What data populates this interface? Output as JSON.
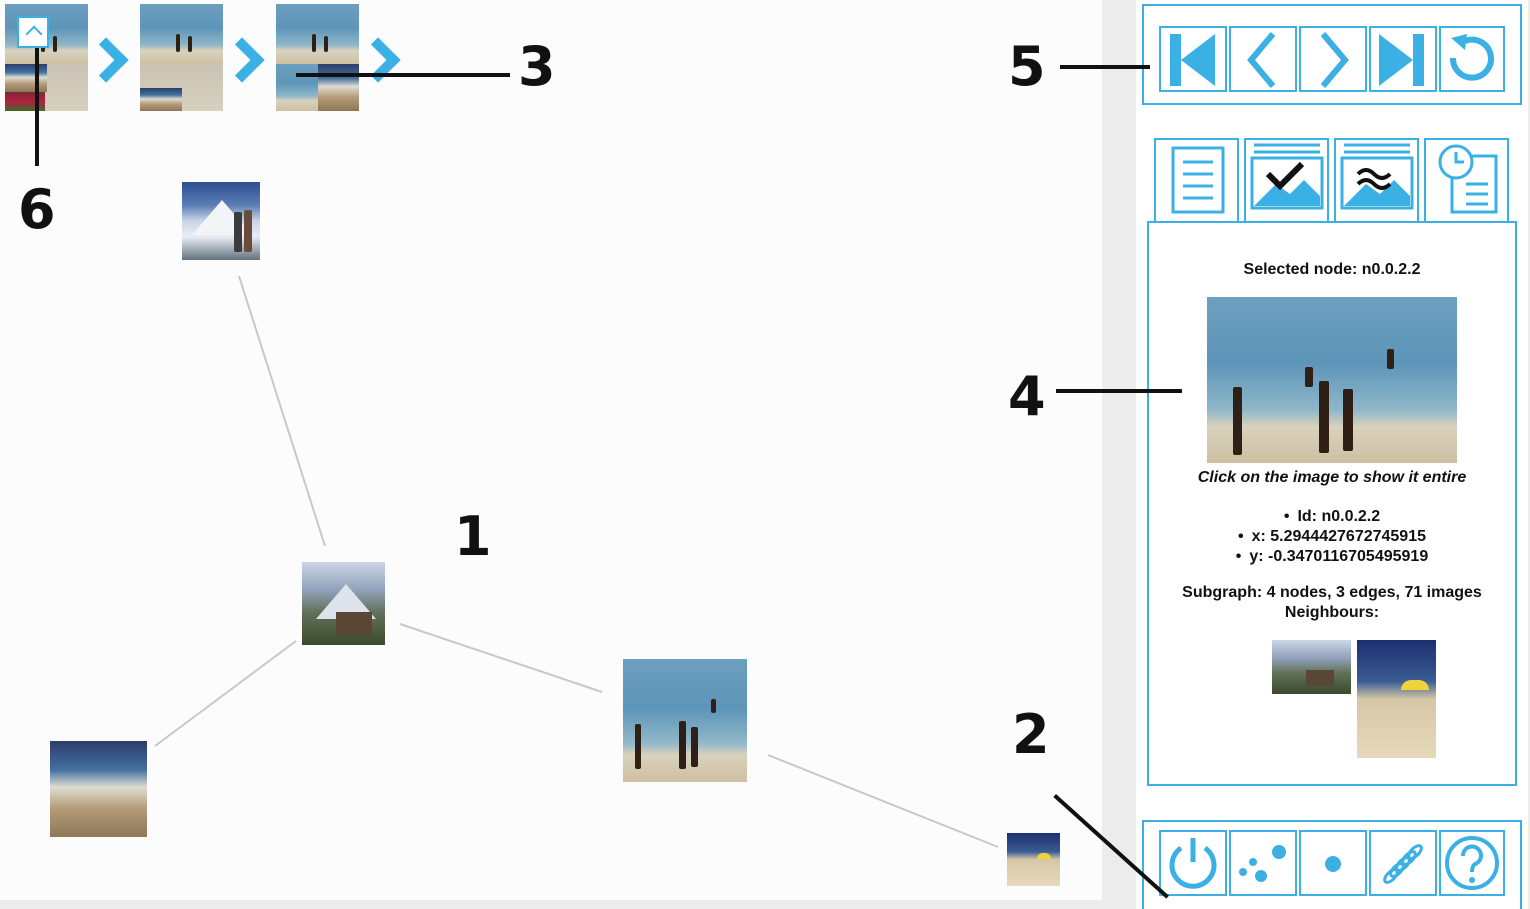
{
  "breadcrumb": {
    "back_icon": "chevron-up-icon",
    "arrow_icon": "chevron-right-icon"
  },
  "annotations": [
    "1",
    "2",
    "3",
    "4",
    "5",
    "6"
  ],
  "navigation_toolbar": {
    "buttons": [
      "first-icon",
      "previous-icon",
      "next-icon",
      "last-icon",
      "reset-icon"
    ]
  },
  "tabs": [
    "document-icon",
    "image-check-icon",
    "image-similar-icon",
    "history-icon"
  ],
  "info": {
    "selected_label": "Selected node: n0.0.2.2",
    "image_caption": "Click on the image to show it entire",
    "props": [
      "Id: n0.0.2.2",
      "x: 5.2944427672745915",
      "y: -0.3470116705495919"
    ],
    "subgraph": "Subgraph: 4 nodes, 3 edges, 71 images",
    "neighbours_label": "Neighbours:"
  },
  "bottom_toolbar": {
    "buttons": [
      "power-icon",
      "scatter-icon",
      "dot-icon",
      "spring-icon",
      "help-icon"
    ]
  },
  "colors": {
    "accent": "#3bb0e5",
    "edge": "#c8c8c8",
    "annotation": "#111111"
  }
}
